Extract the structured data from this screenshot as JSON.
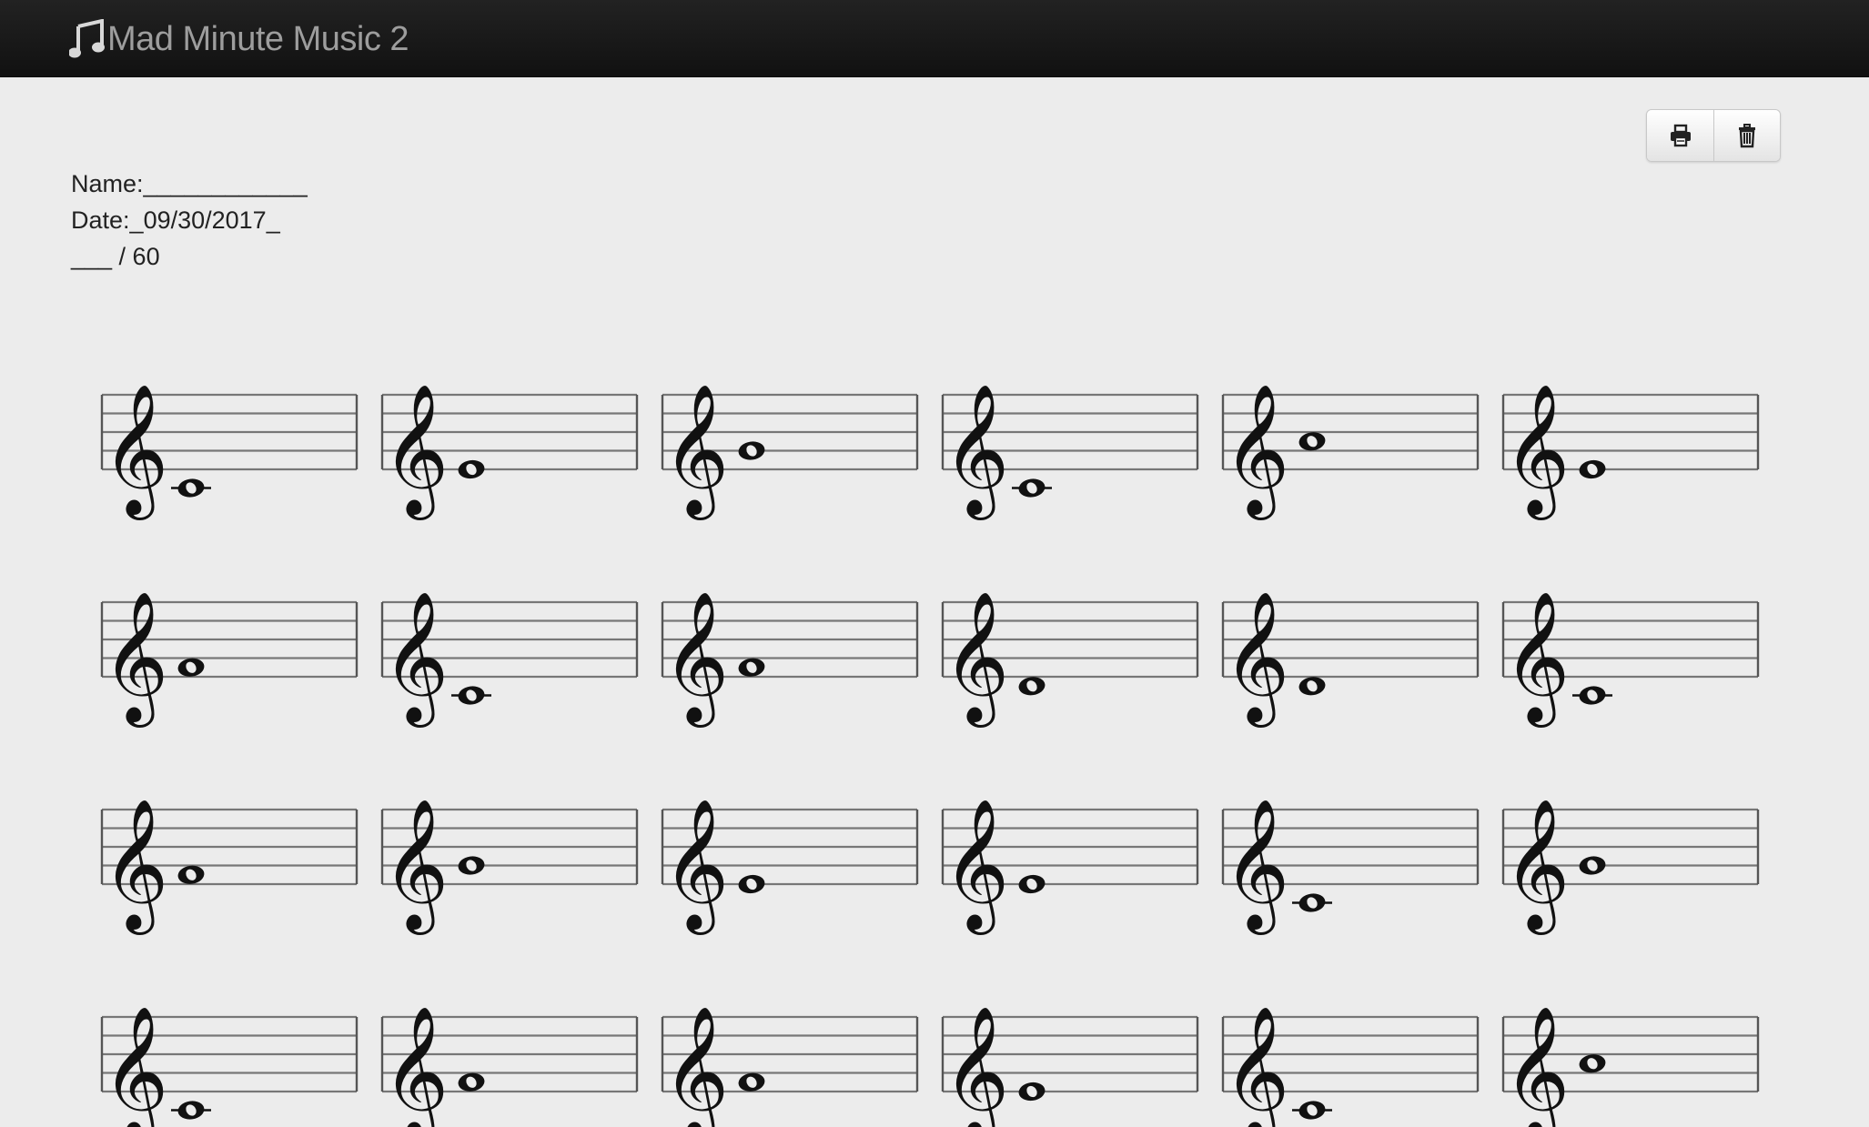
{
  "app": {
    "title": "Mad Minute Music 2",
    "brand_icon": "music-note-icon"
  },
  "toolbar": {
    "print_icon": "print-icon",
    "delete_icon": "trash-icon"
  },
  "worksheet": {
    "name_line": "Name:____________",
    "date_label": "Date:",
    "date_value": "_09/30/2017_",
    "score_line": "___ / 60"
  },
  "staves": {
    "clef": "treble",
    "rows": 4,
    "columns": 6,
    "notes": [
      "C4",
      "E4",
      "G4",
      "C4",
      "A4",
      "E4",
      "F4",
      "C4",
      "F4",
      "D4",
      "D4",
      "C4",
      "F4",
      "G4",
      "E4",
      "E4",
      "C4",
      "G4",
      "C4",
      "F4",
      "F4",
      "E4",
      "C4",
      "A4"
    ]
  }
}
